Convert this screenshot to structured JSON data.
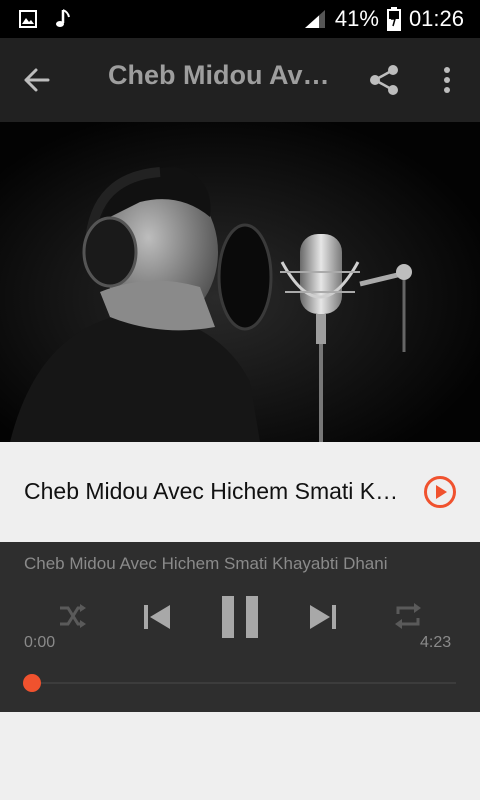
{
  "status_bar": {
    "battery_percent": "41%",
    "time": "01:26",
    "icons": [
      "image-icon",
      "music-note-icon",
      "signal-icon",
      "battery-icon"
    ]
  },
  "app_bar": {
    "title": "Cheb Midou Avec Hichem Smati Khayabti Dhani",
    "back_icon": "arrow-left-icon",
    "share_icon": "share-icon",
    "more_icon": "more-vertical-icon"
  },
  "song_row": {
    "title": "Cheb Midou Avec Hichem Smati Khayabti Dhani",
    "play_icon": "play-circle-icon"
  },
  "player": {
    "now_playing": "Cheb Midou Avec Hichem Smati Khayabti Dhani",
    "current_time": "0:00",
    "total_time": "4:23",
    "progress_fraction": 0.0,
    "controls": [
      "shuffle-icon",
      "skip-previous-icon",
      "pause-icon",
      "skip-next-icon",
      "repeat-icon"
    ]
  },
  "colors": {
    "accent": "#f0522e",
    "appbar_bg": "#212121",
    "player_bg": "#2e2e2e",
    "page_bg": "#efefef"
  }
}
